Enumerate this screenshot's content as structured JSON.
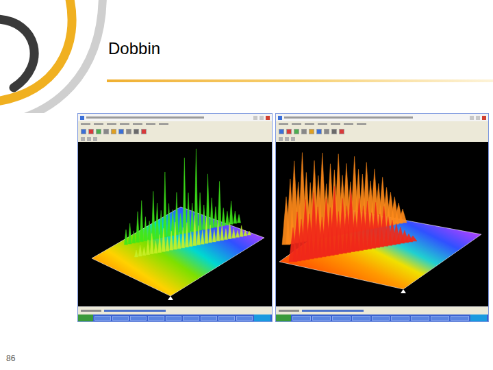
{
  "slide": {
    "title": "Dobbin",
    "page_number": "86"
  },
  "screenshots": [
    {
      "chart": {
        "series": [
          {
            "color": "#3ee81a",
            "values": [
              22,
              30,
              18,
              45,
              60,
              35,
              28,
              70,
              52,
              40,
              95,
              48,
              38,
              62,
              30,
              110,
              58,
              42,
              120,
              55,
              36,
              80,
              44,
              30,
              66,
              26,
              20,
              34,
              18,
              12
            ]
          },
          {
            "color": "#c8f028",
            "values": [
              10,
              16,
              12,
              22,
              30,
              18,
              26,
              34,
              20,
              28,
              40,
              24,
              30,
              36,
              22,
              44,
              28,
              20,
              38,
              26,
              18,
              30,
              22,
              16,
              24,
              14,
              10,
              16,
              8,
              6
            ]
          }
        ]
      }
    },
    {
      "chart": {
        "series": [
          {
            "color": "#ff8a1a",
            "values": [
              70,
              95,
              120,
              88,
              130,
              100,
              84,
              115,
              92,
              124,
              78,
              106,
              96,
              118,
              86,
              102,
              74,
              110,
              90,
              82,
              98,
              70,
              86,
              64,
              72,
              56,
              48,
              40,
              30,
              20
            ]
          },
          {
            "color": "#f0281a",
            "values": [
              50,
              72,
              60,
              88,
              66,
              96,
              74,
              58,
              84,
              70,
              100,
              62,
              80,
              68,
              92,
              58,
              76,
              64,
              70,
              52,
              66,
              48,
              58,
              42,
              36,
              30,
              24,
              18,
              12,
              8
            ]
          }
        ]
      }
    }
  ]
}
